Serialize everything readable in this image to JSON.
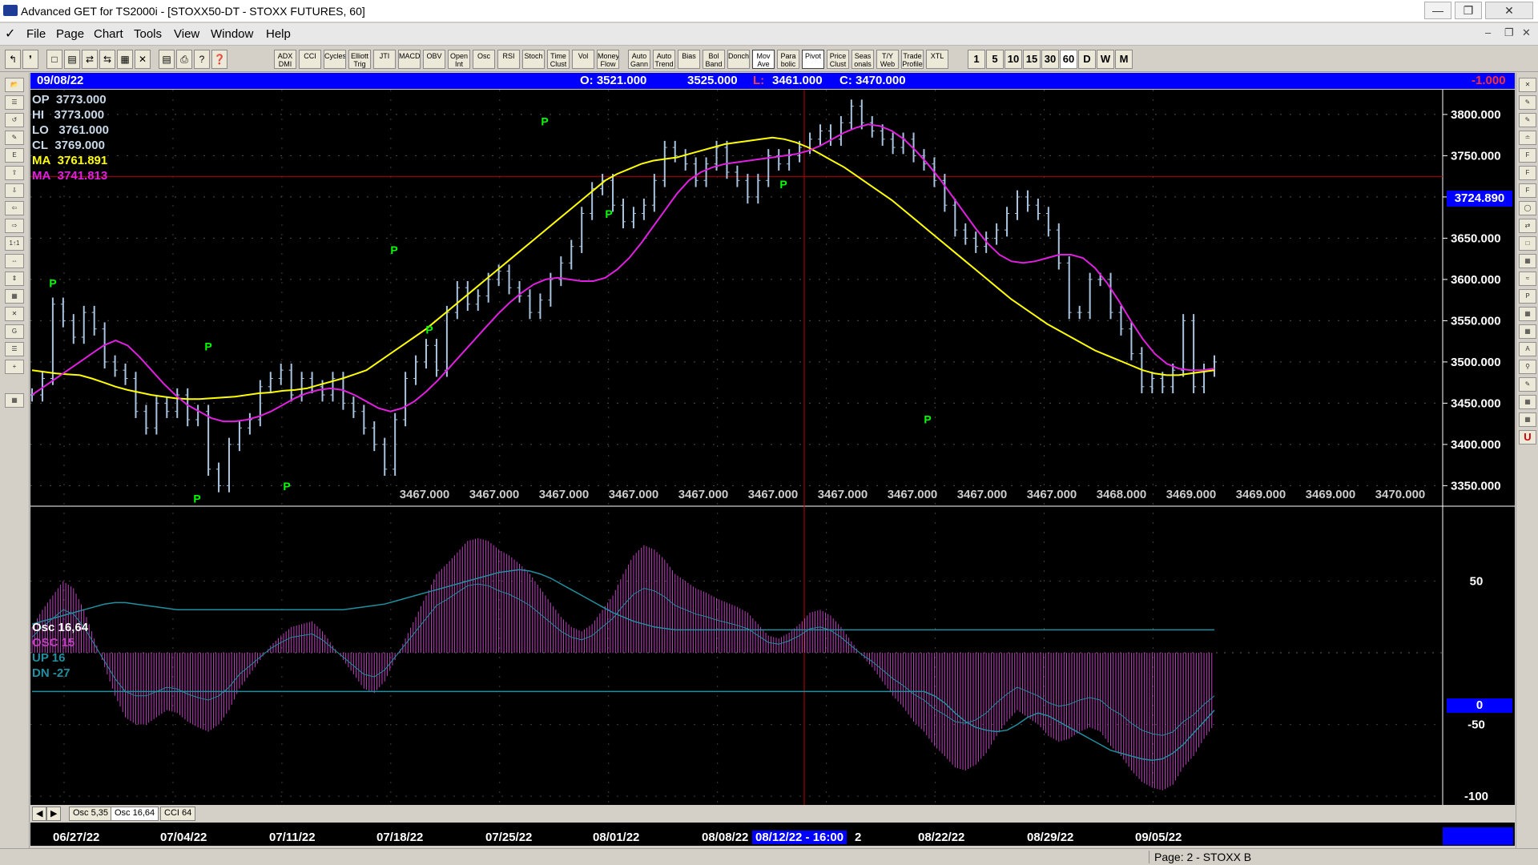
{
  "window": {
    "title": "Advanced GET for TS2000i - [STOXX50-DT - STOXX FUTURES, 60]"
  },
  "menu": [
    "File",
    "Page",
    "Chart",
    "Tools",
    "View",
    "Window",
    "Help"
  ],
  "toolbar": {
    "indicators": [
      "ADX DMI",
      "CCI",
      "Cycles",
      "Elliott Trig",
      "JTI",
      "MACD",
      "OBV",
      "Open Int",
      "Osc",
      "RSI",
      "Stoch",
      "Time Clust",
      "Vol",
      "Money Flow",
      "Auto Gann",
      "Auto Trend",
      "Bias",
      "Bol Band",
      "Donch",
      "Mov Ave",
      "Para bolic",
      "Pivot",
      "Price Clust",
      "Seas onals",
      "T/Y Web",
      "Trade Profile",
      "XTL"
    ],
    "intervals": [
      "1",
      "5",
      "10",
      "15",
      "30",
      "60",
      "D",
      "W",
      "M"
    ],
    "selected_interval": "60"
  },
  "pricebar": {
    "date": "09/08/22",
    "open": "O: 3521.000",
    "high": "3525.000",
    "low_label": "L:",
    "low": "3461.000",
    "close": "C: 3470.000",
    "change": "-1.000"
  },
  "info": {
    "op": {
      "label": "OP",
      "value": "3773.000"
    },
    "hi": {
      "label": "HI",
      "value": "3773.000"
    },
    "lo": {
      "label": "LO",
      "value": "3761.000"
    },
    "cl": {
      "label": "CL",
      "value": "3769.000"
    },
    "ma1": {
      "label": "MA",
      "value": "3761.891"
    },
    "ma2": {
      "label": "MA",
      "value": "3741.813"
    }
  },
  "crosshair": {
    "price_label": "3724.890",
    "date_label": "08/12/22 - 16:00"
  },
  "bottom_values": [
    "3467.000",
    "3467.000",
    "3467.000",
    "3467.000",
    "3467.000",
    "3467.000",
    "3467.000",
    "3467.000",
    "3467.000",
    "3467.000",
    "3468.000",
    "3469.000",
    "3469.000",
    "3469.000",
    "3470.000"
  ],
  "osc_info": {
    "title": "Osc 16,64",
    "osc": "OSC 15",
    "up": "UP   16",
    "dn": "DN   -27"
  },
  "osc_zero_label": "0",
  "tabs": [
    "Osc 5,35",
    "Osc 16,64",
    "CCI 64"
  ],
  "dates": [
    "06/27/22",
    "07/04/22",
    "07/11/22",
    "07/18/22",
    "07/25/22",
    "08/01/22",
    "08/08/22",
    "2",
    "08/22/22",
    "08/29/22",
    "09/05/22"
  ],
  "status": {
    "page": "Page: 2 - STOXX B"
  },
  "pivot_label": "P",
  "colors": {
    "bars": "#a8c4e0",
    "ma_fast": "#ffff00",
    "ma_slow": "#e020e0",
    "pivot": "#00ff00",
    "osc": "#c040c0",
    "band": "#2090a0",
    "crosshair": "#c00000"
  },
  "chart_data": {
    "type": "line",
    "title": "STOXX50-DT - STOXX FUTURES, 60",
    "xlabel": "",
    "ylabel": "",
    "ylim": [
      3330,
      3830
    ],
    "x_ticks": [
      "06/27/22",
      "07/04/22",
      "07/11/22",
      "07/18/22",
      "07/25/22",
      "08/01/22",
      "08/08/22",
      "08/15/22",
      "08/22/22",
      "08/29/22",
      "09/05/22"
    ],
    "y_ticks": [
      "3350.000",
      "3400.000",
      "3450.000",
      "3500.000",
      "3550.000",
      "3600.000",
      "3650.000",
      "3700.000",
      "3750.000",
      "3800.000"
    ],
    "series": [
      {
        "name": "price",
        "x": [
          0,
          1,
          2,
          3,
          4,
          5,
          6,
          7,
          8,
          9,
          10,
          11,
          12,
          13,
          14,
          15,
          16,
          17,
          18,
          19,
          20,
          21,
          22,
          23,
          24,
          25,
          26,
          27,
          28,
          29,
          30,
          31,
          32,
          33,
          34,
          35,
          36,
          37,
          38,
          39,
          40,
          41,
          42,
          43,
          44,
          45,
          46,
          47,
          48,
          49,
          50,
          51,
          52,
          53,
          54,
          55,
          56,
          57,
          58,
          59,
          60,
          61,
          62,
          63,
          64,
          65,
          66,
          67,
          68,
          69,
          70,
          71,
          72,
          73,
          74,
          75,
          76,
          77,
          78,
          79,
          80,
          81,
          82,
          83,
          84,
          85,
          86,
          87,
          88,
          89,
          90,
          91,
          92,
          93,
          94,
          95,
          96,
          97,
          98,
          99,
          100,
          101,
          102,
          103,
          104,
          105,
          106,
          107,
          108,
          109,
          110,
          111,
          112,
          113,
          114
        ],
        "values": [
          3460,
          3480,
          3570,
          3550,
          3530,
          3560,
          3540,
          3500,
          3490,
          3480,
          3440,
          3420,
          3450,
          3440,
          3460,
          3430,
          3440,
          3370,
          3350,
          3400,
          3420,
          3430,
          3470,
          3480,
          3490,
          3460,
          3480,
          3470,
          3460,
          3480,
          3450,
          3440,
          3420,
          3400,
          3370,
          3430,
          3480,
          3500,
          3520,
          3490,
          3560,
          3590,
          3570,
          3580,
          3600,
          3610,
          3590,
          3580,
          3560,
          3575,
          3600,
          3620,
          3640,
          3680,
          3710,
          3720,
          3690,
          3670,
          3680,
          3690,
          3720,
          3760,
          3750,
          3740,
          3720,
          3740,
          3760,
          3730,
          3720,
          3700,
          3720,
          3750,
          3740,
          3750,
          3760,
          3770,
          3780,
          3770,
          3790,
          3810,
          3790,
          3780,
          3770,
          3760,
          3770,
          3750,
          3740,
          3720,
          3690,
          3660,
          3650,
          3640,
          3650,
          3660,
          3680,
          3700,
          3690,
          3680,
          3660,
          3620,
          3560,
          3560,
          3600,
          3600,
          3560,
          3540,
          3510,
          3470,
          3480,
          3470,
          3490,
          3550,
          3470,
          3490,
          3500
        ],
        "color": "#a8c4e0"
      },
      {
        "name": "MA 3761.891",
        "values": [
          3490,
          3488,
          3486,
          3485,
          3484,
          3480,
          3475,
          3470,
          3466,
          3463,
          3460,
          3458,
          3456,
          3455,
          3455,
          3456,
          3457,
          3458,
          3460,
          3462,
          3463,
          3465,
          3466,
          3468,
          3472,
          3476,
          3480,
          3485,
          3490,
          3500,
          3510,
          3520,
          3530,
          3540,
          3552,
          3564,
          3576,
          3588,
          3600,
          3612,
          3624,
          3636,
          3648,
          3660,
          3672,
          3684,
          3696,
          3708,
          3720,
          3728,
          3734,
          3740,
          3744,
          3746,
          3748,
          3752,
          3756,
          3760,
          3764,
          3766,
          3768,
          3770,
          3772,
          3770,
          3766,
          3760,
          3752,
          3744,
          3736,
          3726,
          3716,
          3706,
          3696,
          3684,
          3672,
          3660,
          3648,
          3636,
          3624,
          3612,
          3600,
          3588,
          3576,
          3566,
          3556,
          3546,
          3538,
          3530,
          3522,
          3514,
          3508,
          3502,
          3496,
          3490,
          3486,
          3484,
          3484,
          3486,
          3488,
          3490
        ],
        "color": "#ffff00"
      },
      {
        "name": "MA 3741.813",
        "values": [
          3460,
          3470,
          3480,
          3490,
          3500,
          3510,
          3520,
          3526,
          3520,
          3506,
          3490,
          3474,
          3460,
          3448,
          3440,
          3432,
          3428,
          3428,
          3430,
          3434,
          3440,
          3448,
          3456,
          3462,
          3466,
          3468,
          3466,
          3460,
          3452,
          3444,
          3440,
          3444,
          3452,
          3464,
          3478,
          3494,
          3510,
          3526,
          3542,
          3558,
          3572,
          3584,
          3594,
          3600,
          3602,
          3600,
          3598,
          3598,
          3602,
          3612,
          3626,
          3644,
          3664,
          3684,
          3704,
          3720,
          3730,
          3736,
          3740,
          3742,
          3744,
          3746,
          3748,
          3750,
          3752,
          3756,
          3762,
          3770,
          3778,
          3784,
          3788,
          3786,
          3780,
          3770,
          3756,
          3740,
          3722,
          3702,
          3682,
          3662,
          3644,
          3630,
          3622,
          3620,
          3622,
          3626,
          3630,
          3630,
          3626,
          3614,
          3596,
          3574,
          3550,
          3528,
          3510,
          3498,
          3492,
          3490,
          3490,
          3492
        ],
        "color": "#e020e0"
      }
    ],
    "pivots": [
      {
        "x": "06/28/22",
        "value": 3585,
        "type": "high"
      },
      {
        "x": "07/06/22",
        "value": 3345,
        "type": "low"
      },
      {
        "x": "07/13/22",
        "value": 3508,
        "type": "high"
      },
      {
        "x": "07/15/22",
        "value": 3360,
        "type": "low"
      },
      {
        "x": "07/21/22",
        "value": 3625,
        "type": "high"
      },
      {
        "x": "07/26/22",
        "value": 3550,
        "type": "low"
      },
      {
        "x": "08/02/22",
        "value": 3781,
        "type": "high"
      },
      {
        "x": "08/08/22",
        "value": 3690,
        "type": "low"
      },
      {
        "x": "08/23/22",
        "value": 3705,
        "type": "high"
      },
      {
        "x": "09/05/22",
        "value": 3441,
        "type": "low"
      }
    ],
    "crosshair_value": 3724.89
  },
  "osc_chart": {
    "type": "bar",
    "ylim": [
      -110,
      100
    ],
    "y_ticks": [
      "50",
      "0",
      "-50",
      "-100"
    ],
    "osc_values": [
      18,
      30,
      40,
      50,
      45,
      30,
      10,
      -10,
      -30,
      -45,
      -50,
      -50,
      -45,
      -40,
      -42,
      -48,
      -52,
      -55,
      -50,
      -40,
      -25,
      -15,
      -5,
      5,
      12,
      18,
      20,
      22,
      15,
      5,
      -5,
      -15,
      -25,
      -28,
      -20,
      -5,
      10,
      25,
      40,
      55,
      62,
      70,
      78,
      80,
      78,
      72,
      68,
      62,
      55,
      45,
      35,
      25,
      18,
      15,
      20,
      30,
      40,
      55,
      68,
      75,
      72,
      65,
      55,
      50,
      45,
      42,
      38,
      35,
      32,
      28,
      20,
      12,
      10,
      14,
      20,
      28,
      30,
      26,
      18,
      8,
      -2,
      -10,
      -20,
      -30,
      -38,
      -48,
      -55,
      -65,
      -72,
      -80,
      -82,
      -78,
      -70,
      -58,
      -48,
      -40,
      -45,
      -50,
      -58,
      -62,
      -60,
      -55,
      -52,
      -55,
      -65,
      -72,
      -82,
      -90,
      -94,
      -96,
      -92,
      -80,
      -72,
      -60,
      -50
    ],
    "up_band": [
      20,
      22,
      24,
      26,
      28,
      30,
      32,
      34,
      35,
      35,
      34,
      33,
      32,
      31,
      30,
      30,
      30,
      30,
      30,
      30,
      30,
      30,
      30,
      30,
      30,
      30,
      30,
      30,
      30,
      30,
      30,
      31,
      32,
      33,
      34,
      36,
      38,
      40,
      42,
      44,
      46,
      48,
      50,
      52,
      54,
      56,
      57,
      58,
      57,
      55,
      52,
      48,
      44,
      40,
      36,
      32,
      28,
      25,
      22,
      20,
      18,
      17,
      16,
      16,
      16,
      16,
      16,
      16,
      16,
      16,
      16,
      16,
      16,
      16,
      16,
      16,
      16,
      16,
      16,
      16,
      16,
      16,
      16,
      16,
      16,
      16,
      16,
      16,
      16,
      16,
      16,
      16,
      16,
      16,
      16,
      16,
      16,
      16,
      16,
      16,
      16,
      16,
      16,
      16,
      16,
      16,
      16,
      16,
      16,
      16,
      16,
      16,
      16,
      16,
      16
    ],
    "dn_band": [
      -27,
      -27,
      -27,
      -27,
      -27,
      -27,
      -27,
      -27,
      -27,
      -27,
      -27,
      -27,
      -27,
      -27,
      -27,
      -27,
      -27,
      -27,
      -27,
      -27,
      -27,
      -27,
      -27,
      -27,
      -27,
      -27,
      -27,
      -27,
      -27,
      -27,
      -27,
      -27,
      -27,
      -27,
      -27,
      -27,
      -27,
      -27,
      -27,
      -27,
      -27,
      -27,
      -27,
      -27,
      -27,
      -27,
      -27,
      -27,
      -27,
      -27,
      -27,
      -27,
      -27,
      -27,
      -27,
      -27,
      -27,
      -27,
      -27,
      -27,
      -27,
      -27,
      -27,
      -27,
      -27,
      -27,
      -27,
      -27,
      -27,
      -27,
      -27,
      -27,
      -27,
      -27,
      -27,
      -27,
      -27,
      -27,
      -27,
      -27,
      -27,
      -27,
      -27,
      -27,
      -27,
      -27,
      -27,
      -30,
      -35,
      -42,
      -48,
      -52,
      -54,
      -55,
      -54,
      -50,
      -45,
      -42,
      -44,
      -48,
      -52,
      -56,
      -60,
      -64,
      -68,
      -70,
      -72,
      -74,
      -75,
      -74,
      -70,
      -64,
      -56,
      -48,
      -40
    ]
  }
}
